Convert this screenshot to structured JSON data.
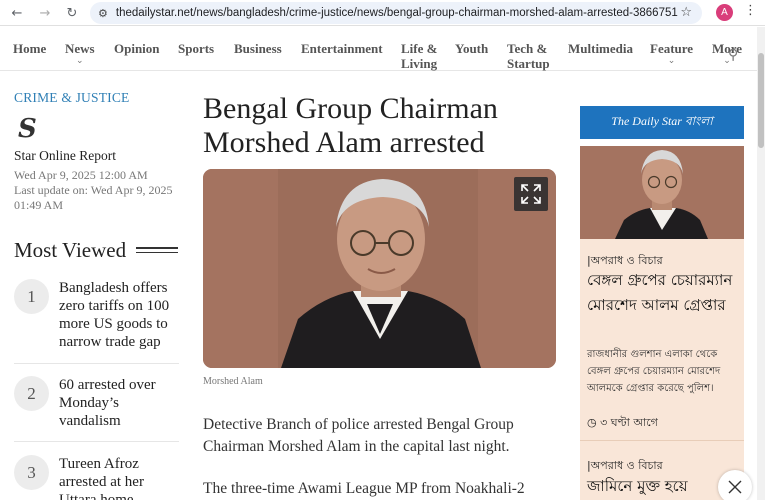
{
  "browser": {
    "url": "thedailystar.net/news/bangladesh/crime-justice/news/bengal-group-chairman-morshed-alam-arrested-3866751",
    "profile_initial": "A"
  },
  "nav": {
    "items": [
      {
        "label": "Home",
        "chevron": false
      },
      {
        "label": "News",
        "chevron": true
      },
      {
        "label": "Opinion",
        "chevron": false
      },
      {
        "label": "Sports",
        "chevron": false
      },
      {
        "label": "Business",
        "chevron": false
      },
      {
        "label": "Entertainment",
        "chevron": false
      },
      {
        "label": "Life &",
        "label2": "Living",
        "chevron": false
      },
      {
        "label": "Youth",
        "chevron": false
      },
      {
        "label": "Tech &",
        "label2": "Startup",
        "chevron": false
      },
      {
        "label": "Multimedia",
        "chevron": false
      },
      {
        "label": "Feature",
        "chevron": true
      },
      {
        "label": "More",
        "chevron": true
      }
    ]
  },
  "article": {
    "section": "CRIME & JUSTICE",
    "author": "Star Online Report",
    "published": "Wed Apr 9, 2025 12:00 AM",
    "updated": "Last update on: Wed Apr 9, 2025 01:49 AM",
    "headline": "Bengal Group Chairman Morshed Alam arrested",
    "caption": "Morshed Alam",
    "para1": "Detective Branch of police arrested Bengal Group Chairman Morshed Alam in the capital last night.",
    "para2": "The three-time Awami League MP from Noakhali-2"
  },
  "most_viewed": {
    "title": "Most Viewed",
    "items": [
      {
        "num": "1",
        "title": "Bangladesh offers zero tariffs on 100 more US goods to narrow trade gap"
      },
      {
        "num": "2",
        "title": "60 arrested over Monday’s vandalism"
      },
      {
        "num": "3",
        "title": "Tureen Afroz arrested at her Uttara home"
      }
    ]
  },
  "bangla": {
    "header": "The Daily Star বাংলা",
    "tag1": "|অপরাধ ও বিচার",
    "title1": "বেঙ্গল গ্রুপের চেয়ারম্যান মোরশেদ আলম গ্রেপ্তার",
    "summary1": "রাজধানীর গুলশান এলাকা থেকে বেঙ্গল গ্রুপের চেয়ারম্যান মোরশেদ আলমকে গ্রেপ্তার করেছে পুলিশ।",
    "time1": "৩ ঘণ্টা আগে",
    "tag2": "|অপরাধ ও বিচার",
    "title2": "জামিনে মুক্ত হয়ে"
  },
  "colors": {
    "accent": "#2f7fb5",
    "bangla_header": "#1e73be",
    "bangla_card": "#f9e6d8"
  }
}
